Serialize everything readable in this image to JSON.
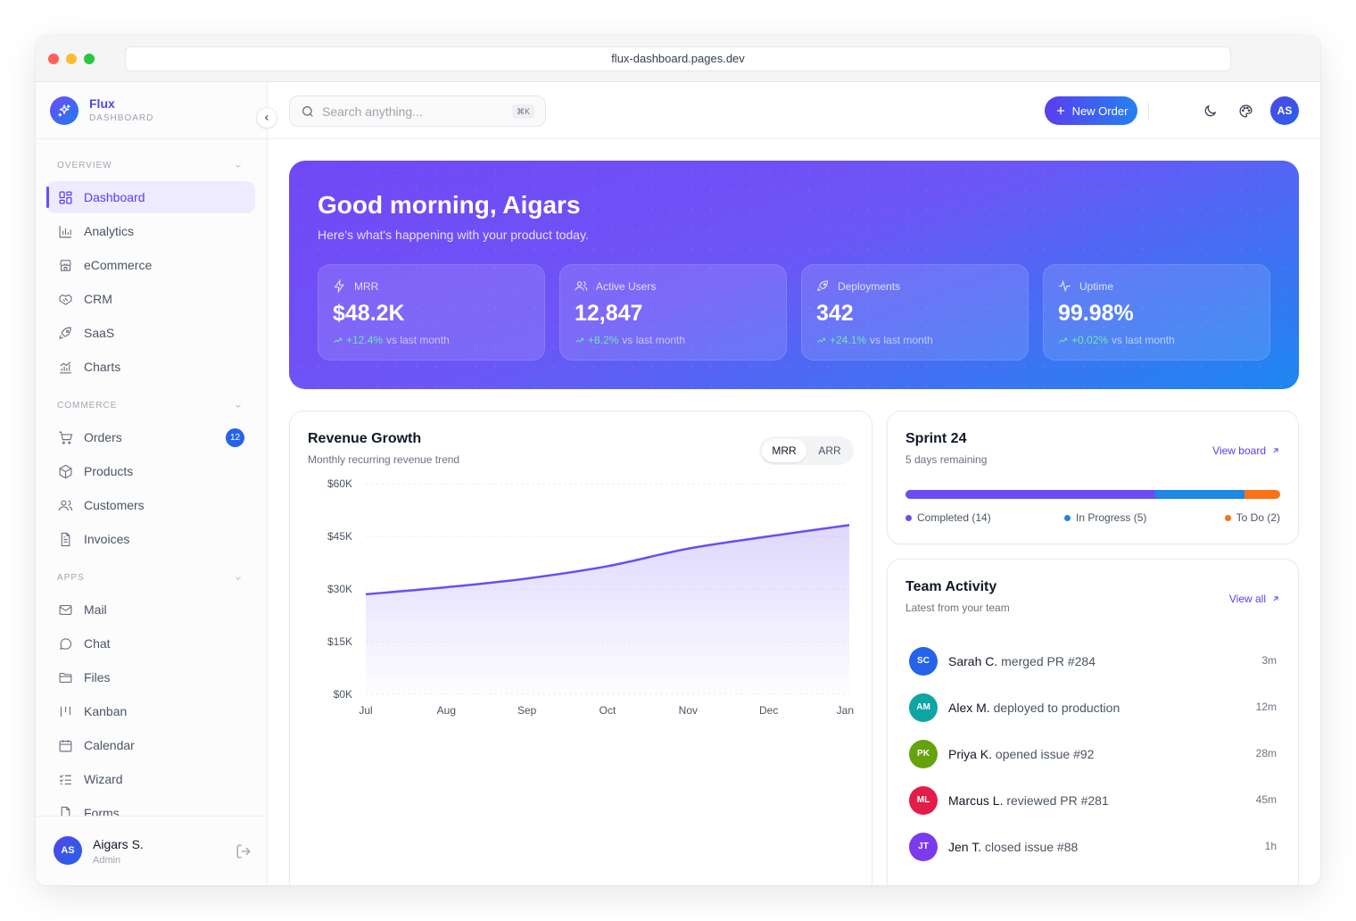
{
  "browser": {
    "url": "flux-dashboard.pages.dev"
  },
  "brand": {
    "name": "Flux",
    "subtitle": "DASHBOARD"
  },
  "sidebar": {
    "sections": [
      {
        "label": "OVERVIEW",
        "items": [
          {
            "label": "Dashboard",
            "icon": "grid-icon",
            "active": true
          },
          {
            "label": "Analytics",
            "icon": "bar-chart-icon"
          },
          {
            "label": "eCommerce",
            "icon": "store-icon"
          },
          {
            "label": "CRM",
            "icon": "handshake-icon"
          },
          {
            "label": "SaaS",
            "icon": "rocket-icon"
          },
          {
            "label": "Charts",
            "icon": "chart-icon"
          }
        ]
      },
      {
        "label": "COMMERCE",
        "items": [
          {
            "label": "Orders",
            "icon": "cart-icon",
            "badge": "12"
          },
          {
            "label": "Products",
            "icon": "box-icon"
          },
          {
            "label": "Customers",
            "icon": "users-icon"
          },
          {
            "label": "Invoices",
            "icon": "file-icon"
          }
        ]
      },
      {
        "label": "APPS",
        "items": [
          {
            "label": "Mail",
            "icon": "mail-icon"
          },
          {
            "label": "Chat",
            "icon": "chat-icon"
          },
          {
            "label": "Files",
            "icon": "folder-icon"
          },
          {
            "label": "Kanban",
            "icon": "kanban-icon"
          },
          {
            "label": "Calendar",
            "icon": "calendar-icon"
          },
          {
            "label": "Wizard",
            "icon": "checklist-icon"
          },
          {
            "label": "Forms",
            "icon": "form-icon"
          }
        ]
      }
    ],
    "user": {
      "initials": "AS",
      "name": "Aigars S.",
      "role": "Admin"
    }
  },
  "header": {
    "search_placeholder": "Search anything...",
    "search_shortcut": "⌘K",
    "new_order_label": "New Order",
    "avatar_initials": "AS",
    "notification_color": "#ef4444"
  },
  "hero": {
    "title": "Good morning, Aigars",
    "subtitle": "Here's what's happening with your product today.",
    "stats": [
      {
        "label": "MRR",
        "value": "$48.2K",
        "change": "+12.4%",
        "suffix": "vs last month",
        "icon": "bolt-icon"
      },
      {
        "label": "Active Users",
        "value": "12,847",
        "change": "+8.2%",
        "suffix": "vs last month",
        "icon": "users-icon"
      },
      {
        "label": "Deployments",
        "value": "342",
        "change": "+24.1%",
        "suffix": "vs last month",
        "icon": "rocket-icon"
      },
      {
        "label": "Uptime",
        "value": "99.98%",
        "change": "+0.02%",
        "suffix": "vs last month",
        "icon": "pulse-icon"
      }
    ]
  },
  "revenue": {
    "title": "Revenue Growth",
    "subtitle": "Monthly recurring revenue trend",
    "toggle": [
      "MRR",
      "ARR"
    ],
    "active_toggle": "MRR"
  },
  "chart_data": {
    "type": "area",
    "title": "Revenue Growth",
    "x": [
      "Jul",
      "Aug",
      "Sep",
      "Oct",
      "Nov",
      "Dec",
      "Jan"
    ],
    "series": [
      {
        "values": [
          28500,
          30500,
          33000,
          36500,
          41500,
          45000,
          48200
        ]
      }
    ],
    "yticks": [
      "$0K",
      "$15K",
      "$30K",
      "$45K",
      "$60K"
    ],
    "ylim": [
      0,
      60000
    ],
    "grid": true,
    "color": "#6d4cf6"
  },
  "sprint": {
    "title": "Sprint 24",
    "subtitle": "5 days remaining",
    "link": "View board",
    "segments": [
      {
        "label": "Completed (14)",
        "value": 14,
        "color": "#6d4cf6"
      },
      {
        "label": "In Progress (5)",
        "value": 5,
        "color": "#1d87e4"
      },
      {
        "label": "To Do (2)",
        "value": 2,
        "color": "#f97316"
      }
    ]
  },
  "activity": {
    "title": "Team Activity",
    "subtitle": "Latest from your team",
    "link": "View all",
    "items": [
      {
        "initials": "SC",
        "who": "Sarah C.",
        "action": "merged PR #284",
        "time": "3m",
        "color": "#2563eb"
      },
      {
        "initials": "AM",
        "who": "Alex M.",
        "action": "deployed to production",
        "time": "12m",
        "color": "#0ea5a4"
      },
      {
        "initials": "PK",
        "who": "Priya K.",
        "action": "opened issue #92",
        "time": "28m",
        "color": "#65a30d"
      },
      {
        "initials": "ML",
        "who": "Marcus L.",
        "action": "reviewed PR #281",
        "time": "45m",
        "color": "#e11d48"
      },
      {
        "initials": "JT",
        "who": "Jen T.",
        "action": "closed issue #88",
        "time": "1h",
        "color": "#7c3aed"
      }
    ]
  }
}
